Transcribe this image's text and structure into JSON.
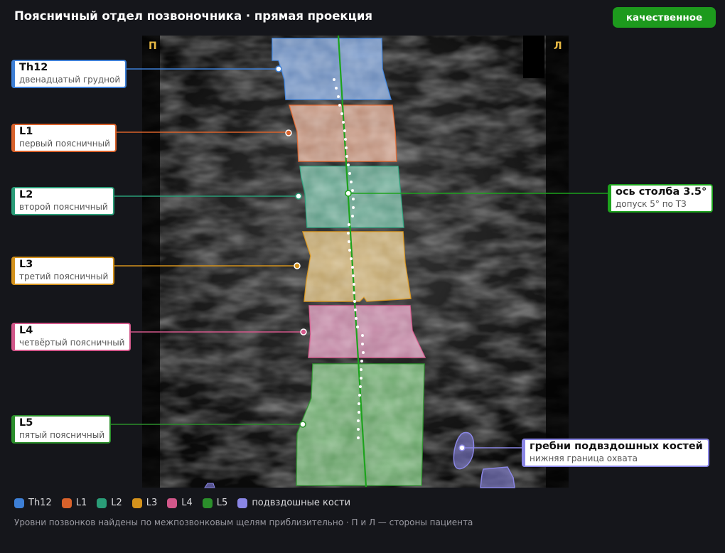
{
  "header": {
    "title": "Поясничный отдел позвоночника · прямая проекция",
    "badge": "качественное"
  },
  "sides": {
    "right": "П",
    "left": "Л"
  },
  "vertebrae": [
    {
      "code": "Th12",
      "name": "двенадцатый грудной",
      "color": "#3d7fd6"
    },
    {
      "code": "L1",
      "name": "первый поясничный",
      "color": "#d9622b"
    },
    {
      "code": "L2",
      "name": "второй поясничный",
      "color": "#2a9d78"
    },
    {
      "code": "L3",
      "name": "третий поясничный",
      "color": "#d4921c"
    },
    {
      "code": "L4",
      "name": "четвёртый поясничный",
      "color": "#d2578a"
    },
    {
      "code": "L5",
      "name": "пятый поясничный",
      "color": "#2b8f2b"
    }
  ],
  "axis": {
    "title": "ось столба 3.5°",
    "note": "допуск 5° по ТЗ",
    "color": "#1da31d"
  },
  "iliac": {
    "title": "гребни подвздошных костей",
    "note": "нижняя граница охвата",
    "color": "#8a86e6"
  },
  "legend": [
    {
      "label": "Th12",
      "color": "#3d7fd6"
    },
    {
      "label": "L1",
      "color": "#d9622b"
    },
    {
      "label": "L2",
      "color": "#2a9d78"
    },
    {
      "label": "L3",
      "color": "#d4921c"
    },
    {
      "label": "L4",
      "color": "#d2578a"
    },
    {
      "label": "L5",
      "color": "#2b8f2b"
    },
    {
      "label": "подвздошные кости",
      "color": "#8a86e6"
    }
  ],
  "footnote": "Уровни позвонков найдены по межпозвонковым щелям приблизительно · П и Л — стороны пациента"
}
